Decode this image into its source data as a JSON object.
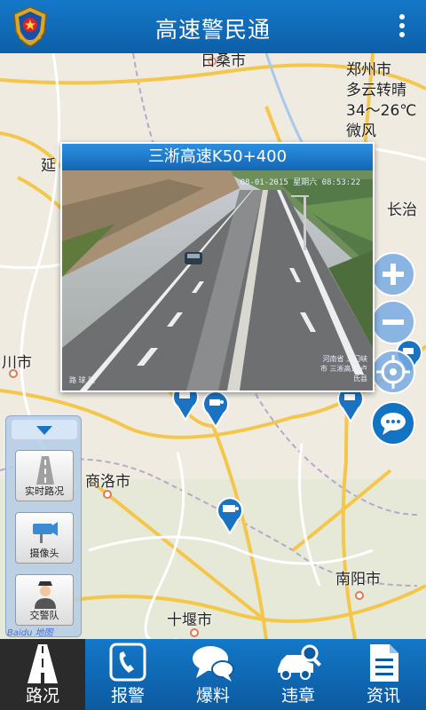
{
  "app": {
    "title": "高速警民通"
  },
  "weather": {
    "city": "郑州市",
    "condition": "多云转晴",
    "temp": "34～26℃",
    "wind": "微风"
  },
  "cities": {
    "top": "日桑市",
    "yan": "延",
    "changzhi": "长治",
    "chuan": "川市",
    "shangluo": "商洛市",
    "nanyang": "南阳市",
    "shiyan": "十堰市"
  },
  "camera_popup": {
    "title": "三淅高速K50+400",
    "stamp": "08-01-2015 星期六 08:53:22",
    "caption_right": "河南省 三门峡市 三淅高速 卢氏县",
    "caption_left": "路 球 路"
  },
  "side_panel": {
    "items": [
      {
        "label": "实时路况",
        "icon": "road-icon"
      },
      {
        "label": "摄像头",
        "icon": "camera-icon"
      },
      {
        "label": "交警队",
        "icon": "police-icon"
      }
    ]
  },
  "map_attribution": "Baidu 地图",
  "nav": [
    {
      "label": "路况",
      "icon": "road-icon",
      "active": true
    },
    {
      "label": "报警",
      "icon": "phone-icon",
      "active": false
    },
    {
      "label": "爆料",
      "icon": "chat-icon",
      "active": false
    },
    {
      "label": "违章",
      "icon": "car-search-icon",
      "active": false
    },
    {
      "label": "资讯",
      "icon": "document-icon",
      "active": false
    }
  ]
}
